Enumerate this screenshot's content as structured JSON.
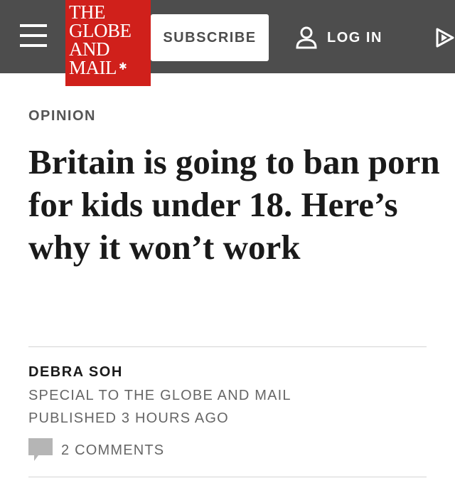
{
  "header": {
    "logo_lines": [
      "THE",
      "GLOBE",
      "AND",
      "MAIL"
    ],
    "subscribe_label": "SUBSCRIBE",
    "login_label": "LOG IN"
  },
  "article": {
    "kicker": "OPINION",
    "headline": "Britain is going to ban porn for kids under 18. Here’s why it won’t work",
    "author": "DEBRA SOH",
    "affiliation": "SPECIAL TO THE GLOBE AND MAIL",
    "published": "PUBLISHED 3 HOURS AGO",
    "comments_label": "2 COMMENTS"
  },
  "colors": {
    "header_bg": "#4d4d4d",
    "logo_red": "#d0201b"
  },
  "icons": [
    "hamburger-menu-icon",
    "maple-leaf-icon",
    "user-icon",
    "play-icon",
    "comment-icon"
  ]
}
